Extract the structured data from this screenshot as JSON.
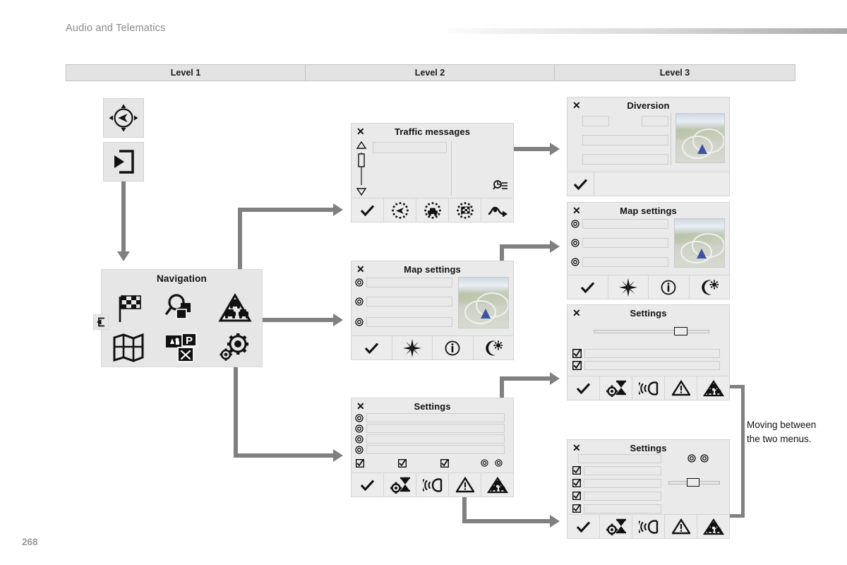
{
  "document": {
    "chapter_title": "Audio and Telematics",
    "page_number": "268"
  },
  "level_bar": {
    "levels": [
      {
        "label": "Level 1"
      },
      {
        "label": "Level 2"
      },
      {
        "label": "Level 3"
      }
    ]
  },
  "level1": {
    "tiles": [
      {
        "icon": "navigation-compass-icon"
      },
      {
        "icon": "enter-menu-icon"
      }
    ],
    "nav_panel": {
      "title": "Navigation",
      "back_icon": "back-exit-icon",
      "items": [
        {
          "icon": "checkered-flag-icon",
          "name": "destination"
        },
        {
          "icon": "magnifier-layers-icon",
          "name": "search-address"
        },
        {
          "icon": "traffic-info-icon",
          "name": "traffic-messages"
        },
        {
          "icon": "map-icon",
          "name": "map"
        },
        {
          "icon": "poi-parking-icon",
          "name": "points-of-interest"
        },
        {
          "icon": "gears-icon",
          "name": "settings"
        }
      ]
    }
  },
  "level2": {
    "traffic_messages": {
      "title": "Traffic messages",
      "close_icon": "close-x-icon",
      "scrollbar": {
        "up_icon": "scroll-up-arrow",
        "down_icon": "scroll-down-arrow"
      },
      "side_icon": "message-list-icon",
      "toolbar": [
        {
          "icon": "check-icon",
          "name": "validate"
        },
        {
          "icon": "dotted-compass-icon",
          "name": "navigation-view"
        },
        {
          "icon": "dotted-car-icon",
          "name": "vehicle-view"
        },
        {
          "icon": "dotted-flag-icon",
          "name": "destination-view"
        },
        {
          "icon": "diversion-icon",
          "name": "diversion"
        }
      ]
    },
    "map_settings": {
      "title": "Map settings",
      "close_icon": "close-x-icon",
      "rows": 3,
      "row_icon": "radio-target-icon",
      "toolbar": [
        {
          "icon": "check-icon",
          "name": "validate"
        },
        {
          "icon": "starburst-icon",
          "name": "brightness"
        },
        {
          "icon": "info-circle-icon",
          "name": "information"
        },
        {
          "icon": "day-night-icon",
          "name": "day-night-mode"
        }
      ]
    },
    "settings": {
      "title": "Settings",
      "close_icon": "close-x-icon",
      "rows": 4,
      "row_icon": "radio-target-icon",
      "check_row_icons": [
        "checkbox-checked-icon",
        "checkbox-checked-icon",
        "checkbox-checked-icon",
        "radio-target-icon",
        "radio-target-icon"
      ],
      "toolbar": [
        {
          "icon": "check-icon",
          "name": "validate"
        },
        {
          "icon": "gear-hourglass-icon",
          "name": "route-criteria"
        },
        {
          "icon": "voice-icon",
          "name": "voice-guidance"
        },
        {
          "icon": "warning-triangle-icon",
          "name": "alerts"
        },
        {
          "icon": "traffic-info-icon",
          "name": "traffic"
        }
      ]
    }
  },
  "level3": {
    "diversion": {
      "title": "Diversion",
      "close_icon": "close-x-icon",
      "thumbnail": "map-preview-thumbnail",
      "toolbar": [
        {
          "icon": "check-icon",
          "name": "validate"
        }
      ]
    },
    "map_settings": {
      "title": "Map settings",
      "close_icon": "close-x-icon",
      "rows": 3,
      "row_icon": "radio-target-icon",
      "thumbnail": "map-preview-thumbnail",
      "toolbar": [
        {
          "icon": "check-icon",
          "name": "validate"
        },
        {
          "icon": "starburst-icon",
          "name": "brightness"
        },
        {
          "icon": "info-circle-icon",
          "name": "information"
        },
        {
          "icon": "day-night-icon",
          "name": "day-night-mode"
        }
      ]
    },
    "settings_top": {
      "title": "Settings",
      "close_icon": "close-x-icon",
      "slider": {
        "name": "volume-slider",
        "position_percent": 72
      },
      "check_rows": [
        "checkbox-checked-icon",
        "checkbox-checked-icon"
      ],
      "toolbar": [
        {
          "icon": "check-icon",
          "name": "validate"
        },
        {
          "icon": "gear-hourglass-icon",
          "name": "route-criteria"
        },
        {
          "icon": "voice-icon",
          "name": "voice-guidance"
        },
        {
          "icon": "warning-triangle-icon",
          "name": "alerts"
        },
        {
          "icon": "traffic-info-icon",
          "name": "traffic"
        }
      ]
    },
    "settings_bottom": {
      "title": "Settings",
      "close_icon": "close-x-icon",
      "slider": {
        "name": "level-slider",
        "position_percent": 46
      },
      "radio_icons": [
        "radio-target-icon",
        "radio-target-icon"
      ],
      "check_rows": [
        "checkbox-checked-icon",
        "checkbox-checked-icon",
        "checkbox-checked-icon",
        "checkbox-checked-icon"
      ],
      "toolbar": [
        {
          "icon": "check-icon",
          "name": "validate"
        },
        {
          "icon": "gear-hourglass-icon",
          "name": "route-criteria"
        },
        {
          "icon": "voice-icon",
          "name": "voice-guidance"
        },
        {
          "icon": "warning-triangle-icon",
          "name": "alerts"
        },
        {
          "icon": "traffic-info-icon",
          "name": "traffic"
        }
      ]
    }
  },
  "annotation": {
    "note": "Moving between the two menus."
  },
  "colors": {
    "connector": "#808080",
    "screen_bg": "#eaeaea",
    "screen_border": "#d4d4d4",
    "panel_bg": "#e6e6e6",
    "header_text": "#8a8a8a",
    "vehicle_marker": "#3a53a4"
  }
}
